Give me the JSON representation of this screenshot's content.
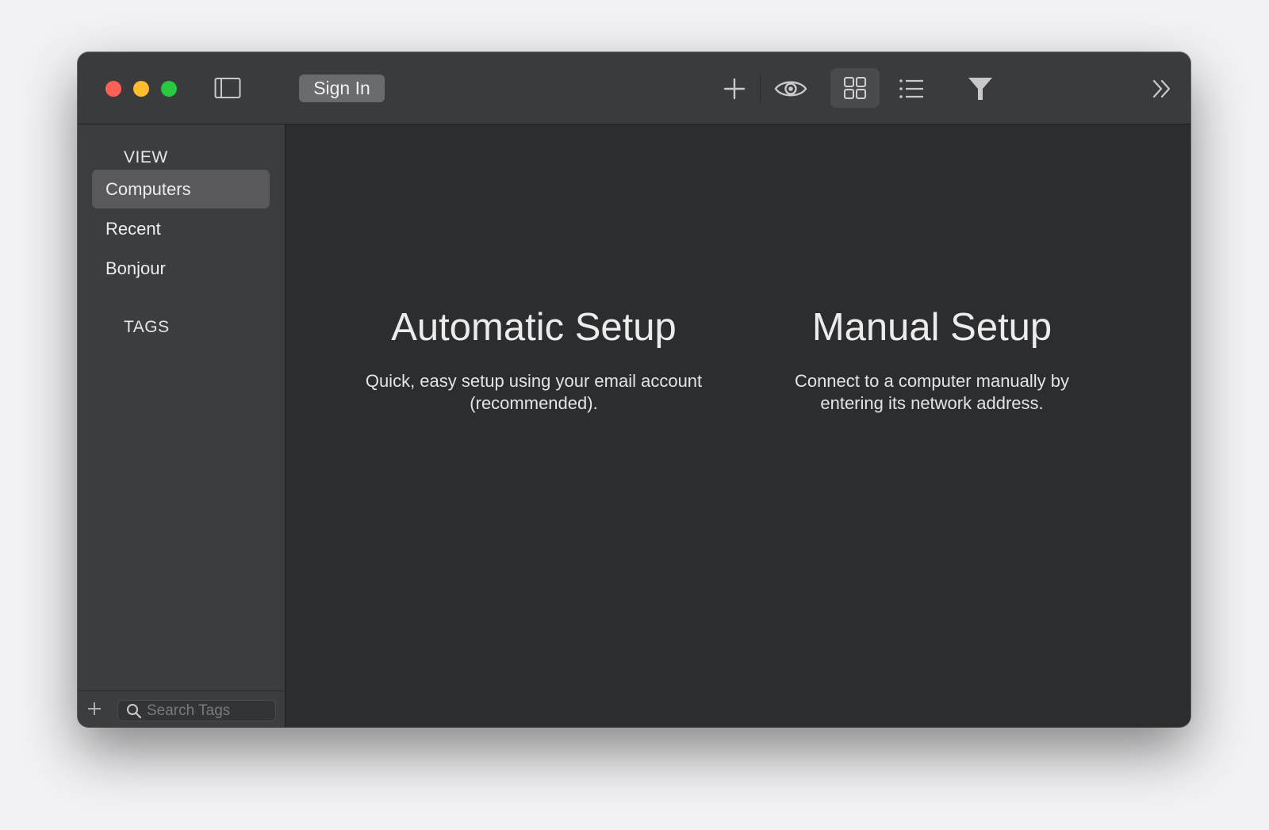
{
  "toolbar": {
    "sign_in_label": "Sign In"
  },
  "sidebar": {
    "view_title": "VIEW",
    "items": [
      {
        "label": "Computers",
        "selected": true
      },
      {
        "label": "Recent",
        "selected": false
      },
      {
        "label": "Bonjour",
        "selected": false
      }
    ],
    "tags_title": "TAGS",
    "search_placeholder": "Search Tags"
  },
  "main": {
    "automatic": {
      "title": "Automatic Setup",
      "description": "Quick, easy setup using your email account (recommended)."
    },
    "manual": {
      "title": "Manual Setup",
      "description": "Connect to a computer manually by entering its network address."
    }
  },
  "icons": {
    "sidebar_toggle": "sidebar-icon",
    "add": "plus-icon",
    "preview": "eye-icon",
    "grid_view": "grid-icon",
    "list_view": "list-icon",
    "filter": "filter-icon",
    "more": "chevron-double-right-icon",
    "search": "search-icon"
  },
  "colors": {
    "close": "#fe5f57",
    "minimize": "#febc2e",
    "zoom": "#28c840",
    "window_bg": "#2c2d2f",
    "sidebar_bg": "#3c3d3f",
    "selected_item": "#59595b"
  }
}
